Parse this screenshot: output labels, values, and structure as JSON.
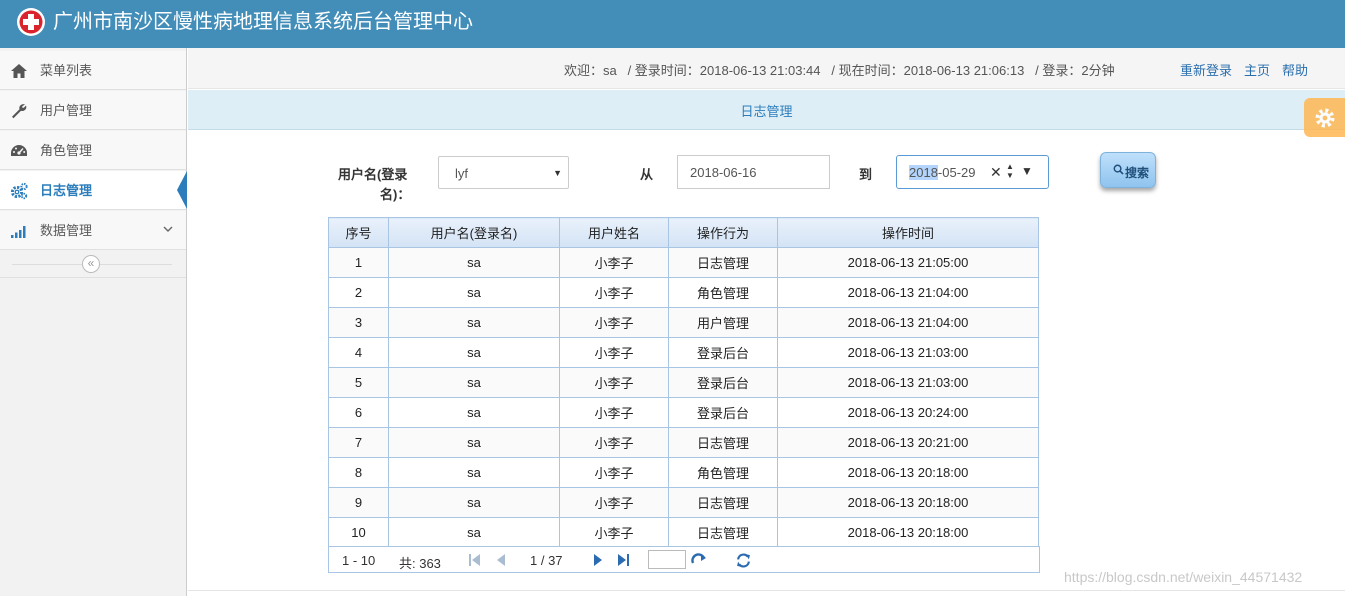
{
  "app": {
    "title": "广州市南沙区慢性病地理信息系统后台管理中心"
  },
  "sidebar": {
    "items": [
      {
        "label": "菜单列表",
        "icon": "home-icon"
      },
      {
        "label": "用户管理",
        "icon": "wrench-icon"
      },
      {
        "label": "角色管理",
        "icon": "dashboard-icon"
      },
      {
        "label": "日志管理",
        "icon": "cogs-icon",
        "active": true
      },
      {
        "label": "数据管理",
        "icon": "bar-chart-icon"
      }
    ],
    "collapse_label": "«"
  },
  "infobar": {
    "welcome": "欢迎：sa",
    "login_time": "/ 登录时间：2018-06-13 21:03:44",
    "now_time": "/ 现在时间：2018-06-13 21:06:13",
    "login_duration": "/ 登录：2分钟",
    "relogin": "重新登录",
    "home": "主页",
    "help": "帮助"
  },
  "page": {
    "title": "日志管理"
  },
  "search": {
    "username_label_line1": "用户名(登录",
    "username_label_line2": "名)：",
    "username_value": "lyf",
    "from_label": "从",
    "from_date": "2018-06-16",
    "to_label": "到",
    "to_date_selected": "2018",
    "to_date_rest": "-05-29",
    "button_label": "搜索"
  },
  "table": {
    "headers": [
      "序号",
      "用户名(登录名)",
      "用户姓名",
      "操作行为",
      "操作时间"
    ],
    "rows": [
      [
        "1",
        "sa",
        "小李子",
        "日志管理",
        "2018-06-13 21:05:00"
      ],
      [
        "2",
        "sa",
        "小李子",
        "角色管理",
        "2018-06-13 21:04:00"
      ],
      [
        "3",
        "sa",
        "小李子",
        "用户管理",
        "2018-06-13 21:04:00"
      ],
      [
        "4",
        "sa",
        "小李子",
        "登录后台",
        "2018-06-13 21:03:00"
      ],
      [
        "5",
        "sa",
        "小李子",
        "登录后台",
        "2018-06-13 21:03:00"
      ],
      [
        "6",
        "sa",
        "小李子",
        "登录后台",
        "2018-06-13 20:24:00"
      ],
      [
        "7",
        "sa",
        "小李子",
        "日志管理",
        "2018-06-13 20:21:00"
      ],
      [
        "8",
        "sa",
        "小李子",
        "角色管理",
        "2018-06-13 20:18:00"
      ],
      [
        "9",
        "sa",
        "小李子",
        "日志管理",
        "2018-06-13 20:18:00"
      ],
      [
        "10",
        "sa",
        "小李子",
        "日志管理",
        "2018-06-13 20:18:00"
      ]
    ]
  },
  "pager": {
    "range": "1 - 10",
    "total": "共: 363",
    "page": "1 / 37"
  },
  "watermark": "https://blog.csdn.net/weixin_44571432",
  "colors": {
    "header": "#438eb9",
    "accent": "#2b7dbc",
    "settings_tab": "#ffb752"
  }
}
